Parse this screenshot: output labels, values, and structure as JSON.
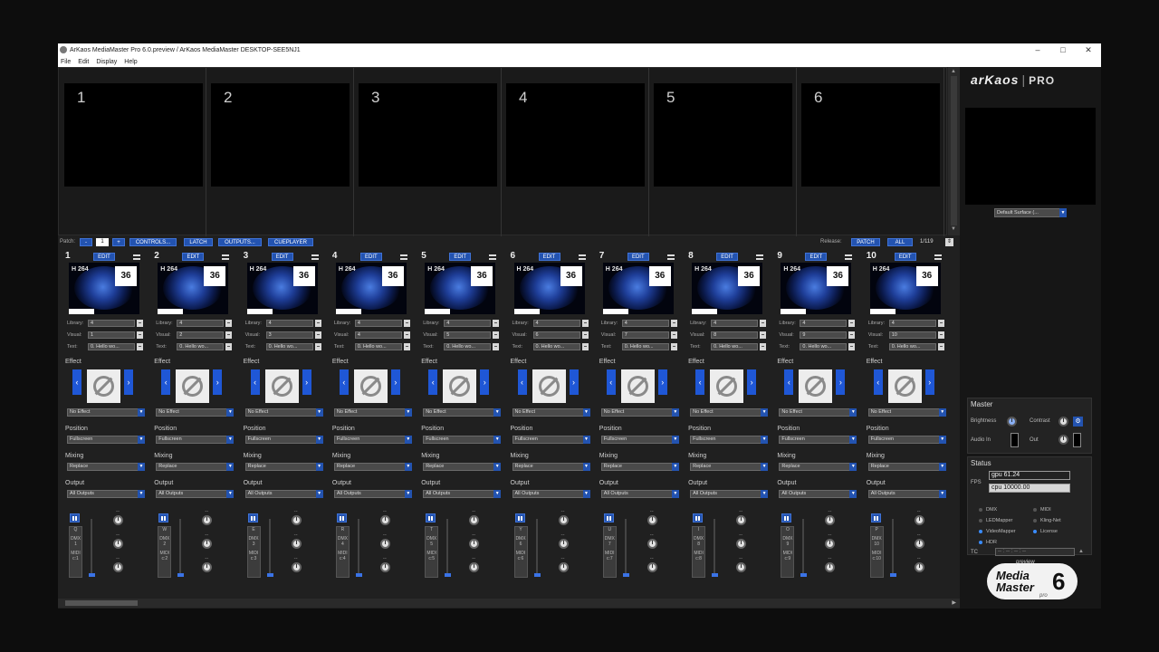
{
  "window": {
    "title": "ArKaos MediaMaster Pro 6.0.preview / ArKaos MediaMaster DESKTOP-SEE5NJ1",
    "minimize": "–",
    "maximize": "□",
    "close": "✕"
  },
  "menu": [
    "File",
    "Edit",
    "Display",
    "Help"
  ],
  "previews": [
    "1",
    "2",
    "3",
    "4",
    "5",
    "6"
  ],
  "patchbar": {
    "label": "Patch:",
    "minus": "-",
    "value": "1",
    "plus": "+",
    "controls": "CONTROLS...",
    "latch": "LATCH",
    "outputs": "OUTPUTS...",
    "cueplayer": "CUEPLAYER",
    "release": "Release:",
    "patch": "PATCH",
    "all": "ALL",
    "page": "1/119"
  },
  "layer_labels": {
    "edit": "EDIT",
    "library": "Library:",
    "visual": "Visual:",
    "text": "Text:",
    "effect": "Effect",
    "position": "Position",
    "mixing": "Mixing",
    "output": "Output",
    "codec": "H 264",
    "dmx": "DMX",
    "midi": "MIDI",
    "dash": "--"
  },
  "layers": [
    {
      "num": "1",
      "id": "36",
      "library": "4",
      "visual": "1",
      "text": "0. Hello wo...",
      "effect": "No Effect",
      "position": "Fullscreen",
      "mixing": "Replace",
      "output": "All Outputs",
      "letter": "Q",
      "dmx": "1",
      "midi": "c:1"
    },
    {
      "num": "2",
      "id": "36",
      "library": "4",
      "visual": "2",
      "text": "0. Hello wo...",
      "effect": "No Effect",
      "position": "Fullscreen",
      "mixing": "Replace",
      "output": "All Outputs",
      "letter": "W",
      "dmx": "2",
      "midi": "c:2"
    },
    {
      "num": "3",
      "id": "36",
      "library": "4",
      "visual": "3",
      "text": "0. Hello wo...",
      "effect": "No Effect",
      "position": "Fullscreen",
      "mixing": "Replace",
      "output": "All Outputs",
      "letter": "E",
      "dmx": "3",
      "midi": "c:3"
    },
    {
      "num": "4",
      "id": "36",
      "library": "4",
      "visual": "4",
      "text": "0. Hello wo...",
      "effect": "No Effect",
      "position": "Fullscreen",
      "mixing": "Replace",
      "output": "All Outputs",
      "letter": "R",
      "dmx": "4",
      "midi": "c:4"
    },
    {
      "num": "5",
      "id": "36",
      "library": "4",
      "visual": "5",
      "text": "0. Hello wo...",
      "effect": "No Effect",
      "position": "Fullscreen",
      "mixing": "Replace",
      "output": "All Outputs",
      "letter": "T",
      "dmx": "5",
      "midi": "c:5"
    },
    {
      "num": "6",
      "id": "36",
      "library": "4",
      "visual": "6",
      "text": "0. Hello wo...",
      "effect": "No Effect",
      "position": "Fullscreen",
      "mixing": "Replace",
      "output": "All Outputs",
      "letter": "Y",
      "dmx": "6",
      "midi": "c:6"
    },
    {
      "num": "7",
      "id": "36",
      "library": "4",
      "visual": "7",
      "text": "0. Hello wo...",
      "effect": "No Effect",
      "position": "Fullscreen",
      "mixing": "Replace",
      "output": "All Outputs",
      "letter": "U",
      "dmx": "7",
      "midi": "c:7"
    },
    {
      "num": "8",
      "id": "36",
      "library": "4",
      "visual": "8",
      "text": "0. Hello wo...",
      "effect": "No Effect",
      "position": "Fullscreen",
      "mixing": "Replace",
      "output": "All Outputs",
      "letter": "I",
      "dmx": "8",
      "midi": "c:8"
    },
    {
      "num": "9",
      "id": "36",
      "library": "4",
      "visual": "9",
      "text": "0. Hello wo...",
      "effect": "No Effect",
      "position": "Fullscreen",
      "mixing": "Replace",
      "output": "All Outputs",
      "letter": "O",
      "dmx": "9",
      "midi": "c:9"
    },
    {
      "num": "10",
      "id": "36",
      "library": "4",
      "visual": "10",
      "text": "0. Hello wo...",
      "effect": "No Effect",
      "position": "Fullscreen",
      "mixing": "Replace",
      "output": "All Outputs",
      "letter": "P",
      "dmx": "10",
      "midi": "c:10"
    }
  ],
  "right": {
    "logo_main": "arKaos",
    "logo_sep": "|",
    "logo_pro": "PRO",
    "surface": "Default Surface (...",
    "master_title": "Master",
    "brightness": "Brightness",
    "contrast": "Contrast",
    "audio_in": "Audio In",
    "out": "Out",
    "status_title": "Status",
    "fps": "FPS",
    "gpu": "gpu 61.24",
    "cpu": "cpu 10000.00",
    "indicators": [
      {
        "label": "DMX",
        "on": false
      },
      {
        "label": "MIDI",
        "on": false
      },
      {
        "label": "LEDMapper",
        "on": false
      },
      {
        "label": "Kling-Net",
        "on": false
      },
      {
        "label": "VideoMapper",
        "on": true
      },
      {
        "label": "License",
        "on": true
      },
      {
        "label": "HDR",
        "on": true
      }
    ],
    "tc": "TC",
    "tc_value": "-- : -- : -- : --",
    "badge_preview": "preview",
    "badge_l1": "Media",
    "badge_l2": "Master",
    "badge_num": "6",
    "badge_pro": "pro"
  },
  "colors": {
    "accent": "#2353b0",
    "accent_border": "#3f72d6",
    "panel": "#202020"
  }
}
